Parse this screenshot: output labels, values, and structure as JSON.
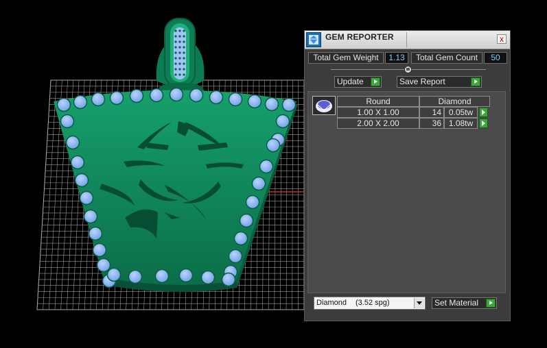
{
  "panel": {
    "title": "GEM REPORTER",
    "close_label": "x",
    "total_weight_label": "Total Gem Weight",
    "total_weight_value": "1.13",
    "total_count_label": "Total Gem Count",
    "total_count_value": "50",
    "update_label": "Update",
    "save_report_label": "Save Report",
    "report": {
      "shape_header": "Round",
      "material_header": "Diamond",
      "rows": [
        {
          "size": "1.00 X 1.00",
          "count": "14",
          "weight": "0.05tw"
        },
        {
          "size": "2.00 X 2.00",
          "count": "36",
          "weight": "1.08tw"
        }
      ]
    },
    "material_select": {
      "name": "Diamond",
      "spg": "(3.52 spg)"
    },
    "set_material_label": "Set Material"
  },
  "colors": {
    "pendant_green": "#0f8a5e",
    "gem_blue": "#86b4f4",
    "value_text": "#7fd0ff",
    "play_button": "#3ca83c",
    "axis_red": "#c8281e"
  },
  "icons": {
    "title": "gem-reporter-icon",
    "close": "close-icon",
    "play": "play-arrow-icon",
    "dropdown": "chevron-down-icon"
  }
}
